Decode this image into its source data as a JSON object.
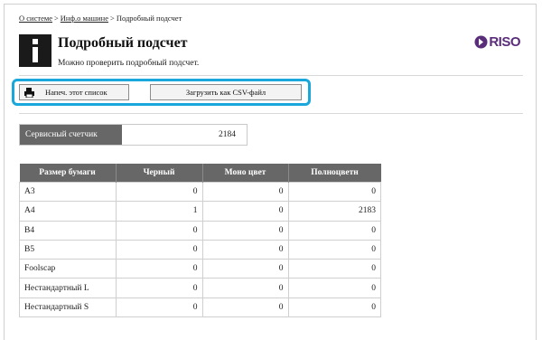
{
  "breadcrumb": {
    "items": [
      {
        "label": "О системе",
        "link": true
      },
      {
        "label": "Инф.о машине",
        "link": true
      },
      {
        "label": "Подробный подсчет",
        "link": false
      }
    ],
    "separator": ">"
  },
  "header": {
    "icon": "info-icon",
    "title": "Подробный подсчет",
    "subtitle": "Можно проверить подробный подсчет.",
    "logo_text": "RISO",
    "logo_color": "#5a2d7a"
  },
  "toolbar": {
    "print_icon": "printer-icon",
    "print_label": "Напеч. этот список",
    "csv_label": "Загрузить как CSV-файл",
    "highlight_color": "#1aa7dc"
  },
  "service_counter": {
    "label": "Сервисный счетчик",
    "value": "2184"
  },
  "table": {
    "header_color": "#676767",
    "columns": [
      "Размер бумаги",
      "Черный",
      "Моно цвет",
      "Полноцветн"
    ],
    "rows": [
      {
        "size": "A3",
        "black": "0",
        "mono": "0",
        "full": "0"
      },
      {
        "size": "A4",
        "black": "1",
        "mono": "0",
        "full": "2183"
      },
      {
        "size": "B4",
        "black": "0",
        "mono": "0",
        "full": "0"
      },
      {
        "size": "B5",
        "black": "0",
        "mono": "0",
        "full": "0"
      },
      {
        "size": "Foolscap",
        "black": "0",
        "mono": "0",
        "full": "0"
      },
      {
        "size": "Нестандартный L",
        "black": "0",
        "mono": "0",
        "full": "0"
      },
      {
        "size": "Нестандартный S",
        "black": "0",
        "mono": "0",
        "full": "0"
      }
    ]
  }
}
